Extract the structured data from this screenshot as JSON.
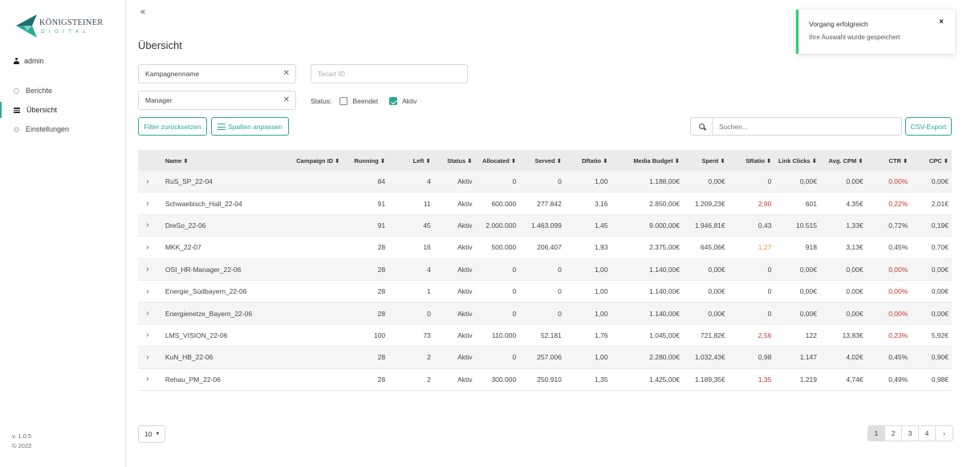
{
  "brand": {
    "name": "KÖNIGSTEINER",
    "sub": "DIGITAL"
  },
  "user": {
    "name": "admin"
  },
  "nav": [
    {
      "label": "Berichte",
      "icon": "circle-icon"
    },
    {
      "label": "Übersicht",
      "icon": "list-icon"
    },
    {
      "label": "Einstellungen",
      "icon": "gear-icon"
    }
  ],
  "version": {
    "line1": "v. 1.0.5",
    "line2": "© 2022"
  },
  "collapse_label": "«",
  "page_title": "Übersicht",
  "filters": {
    "campaign_name": "Kampagnenname",
    "tecart_placeholder": "Tecart ID",
    "manager": "Manager",
    "status_label": "Status:",
    "status_ended": "Beendet",
    "status_active": "Aktiv",
    "reset_label": "Filter zurücksetzen",
    "columns_label": "Spalten anpassen",
    "search_placeholder": "Suchen...",
    "export_label": "CSV-Export"
  },
  "table": {
    "headers": {
      "name": "Name ⬍",
      "cid": "Campaign ID ⬍",
      "run": "Running ⬍",
      "left": "Left ⬍",
      "status": "Status ⬍",
      "alloc": "Allocated ⬍",
      "served": "Served ⬍",
      "dratio": "DRatio ⬍",
      "media": "Media Budget ⬍",
      "spent": "Spent ⬍",
      "sratio": "SRatio ⬍",
      "link": "Link Clicks ⬍",
      "cpm": "Avg. CPM ⬍",
      "ctr": "CTR ⬍",
      "cpc": "CPC ⬍"
    },
    "rows": [
      {
        "name": "RuS_SP_22-04",
        "cid": "",
        "run": "84",
        "left": "4",
        "status": "Aktiv",
        "alloc": "0",
        "served": "0",
        "dratio": "1,00",
        "media": "1.188,00€",
        "spent": "0,00€",
        "sratio": "0",
        "sratio_color": "",
        "link": "0,00€",
        "cpm": "0,00€",
        "ctr": "0,00%",
        "ctr_color": "red",
        "cpc": "0,00€"
      },
      {
        "name": "Schwaebisch_Hall_22-04",
        "cid": "",
        "run": "91",
        "left": "11",
        "status": "Aktiv",
        "alloc": "600.000",
        "served": "277.842",
        "dratio": "3,16",
        "media": "2.850,00€",
        "spent": "1.209,23€",
        "sratio": "2,90",
        "sratio_color": "red",
        "link": "601",
        "cpm": "4,35€",
        "ctr": "0,22%",
        "ctr_color": "red",
        "cpc": "2,01€"
      },
      {
        "name": "DreSo_22-06",
        "cid": "",
        "run": "91",
        "left": "45",
        "status": "Aktiv",
        "alloc": "2.000.000",
        "served": "1.463.099",
        "dratio": "1,45",
        "media": "9.000,00€",
        "spent": "1.946,81€",
        "sratio": "0,43",
        "sratio_color": "",
        "link": "10.515",
        "cpm": "1,33€",
        "ctr": "0,72%",
        "ctr_color": "",
        "cpc": "0,19€"
      },
      {
        "name": "MKK_22-07",
        "cid": "",
        "run": "28",
        "left": "16",
        "status": "Aktiv",
        "alloc": "500.000",
        "served": "206.407",
        "dratio": "1,93",
        "media": "2.375,00€",
        "spent": "645,06€",
        "sratio": "1,27",
        "sratio_color": "orange",
        "link": "918",
        "cpm": "3,13€",
        "ctr": "0,45%",
        "ctr_color": "",
        "cpc": "0,70€"
      },
      {
        "name": "OSI_HR-Manager_22-06",
        "cid": "",
        "run": "28",
        "left": "4",
        "status": "Aktiv",
        "alloc": "0",
        "served": "0",
        "dratio": "1,00",
        "media": "1.140,00€",
        "spent": "0,00€",
        "sratio": "0",
        "sratio_color": "",
        "link": "0,00€",
        "cpm": "0,00€",
        "ctr": "0,00%",
        "ctr_color": "red",
        "cpc": "0,00€"
      },
      {
        "name": "Energie_Südbayern_22-06",
        "cid": "",
        "run": "28",
        "left": "1",
        "status": "Aktiv",
        "alloc": "0",
        "served": "0",
        "dratio": "1,00",
        "media": "1.140,00€",
        "spent": "0,00€",
        "sratio": "0",
        "sratio_color": "",
        "link": "0,00€",
        "cpm": "0,00€",
        "ctr": "0,00%",
        "ctr_color": "red",
        "cpc": "0,00€"
      },
      {
        "name": "Energienetze_Bayern_22-06",
        "cid": "",
        "run": "28",
        "left": "0",
        "status": "Aktiv",
        "alloc": "0",
        "served": "0",
        "dratio": "1,00",
        "media": "1.140,00€",
        "spent": "0,00€",
        "sratio": "0",
        "sratio_color": "",
        "link": "0,00€",
        "cpm": "0,00€",
        "ctr": "0,00%",
        "ctr_color": "red",
        "cpc": "0,00€"
      },
      {
        "name": "LMS_VISION_22-06",
        "cid": "",
        "run": "100",
        "left": "73",
        "status": "Aktiv",
        "alloc": "110.000",
        "served": "52.181",
        "dratio": "1,76",
        "media": "1.045,00€",
        "spent": "721,82€",
        "sratio": "2,56",
        "sratio_color": "red",
        "link": "122",
        "cpm": "13,83€",
        "ctr": "0,23%",
        "ctr_color": "red",
        "cpc": "5,92€"
      },
      {
        "name": "KuN_HB_22-06",
        "cid": "",
        "run": "28",
        "left": "2",
        "status": "Aktiv",
        "alloc": "0",
        "served": "257.006",
        "dratio": "1,00",
        "media": "2.280,00€",
        "spent": "1.032,43€",
        "sratio": "0,98",
        "sratio_color": "",
        "link": "1.147",
        "cpm": "4,02€",
        "ctr": "0,45%",
        "ctr_color": "",
        "cpc": "0,90€"
      },
      {
        "name": "Rehau_PM_22-06",
        "cid": "",
        "run": "28",
        "left": "2",
        "status": "Aktiv",
        "alloc": "300.000",
        "served": "250.910",
        "dratio": "1,35",
        "media": "1.425,00€",
        "spent": "1.189,35€",
        "sratio": "1,35",
        "sratio_color": "red",
        "link": "1.219",
        "cpm": "4,74€",
        "ctr": "0,49%",
        "ctr_color": "",
        "cpc": "0,98€"
      }
    ]
  },
  "pagination": {
    "page_size": "10",
    "pages": [
      "1",
      "2",
      "3",
      "4",
      "›"
    ],
    "active": "1"
  },
  "toast": {
    "title": "Vorgang erfolgreich",
    "message": "Ihre Auswahl wurde gespeichert",
    "close": "×"
  },
  "colors": {
    "accent": "#2aa89a",
    "success": "#2ecc71",
    "danger": "#c0392b",
    "warning": "#e2943a"
  }
}
